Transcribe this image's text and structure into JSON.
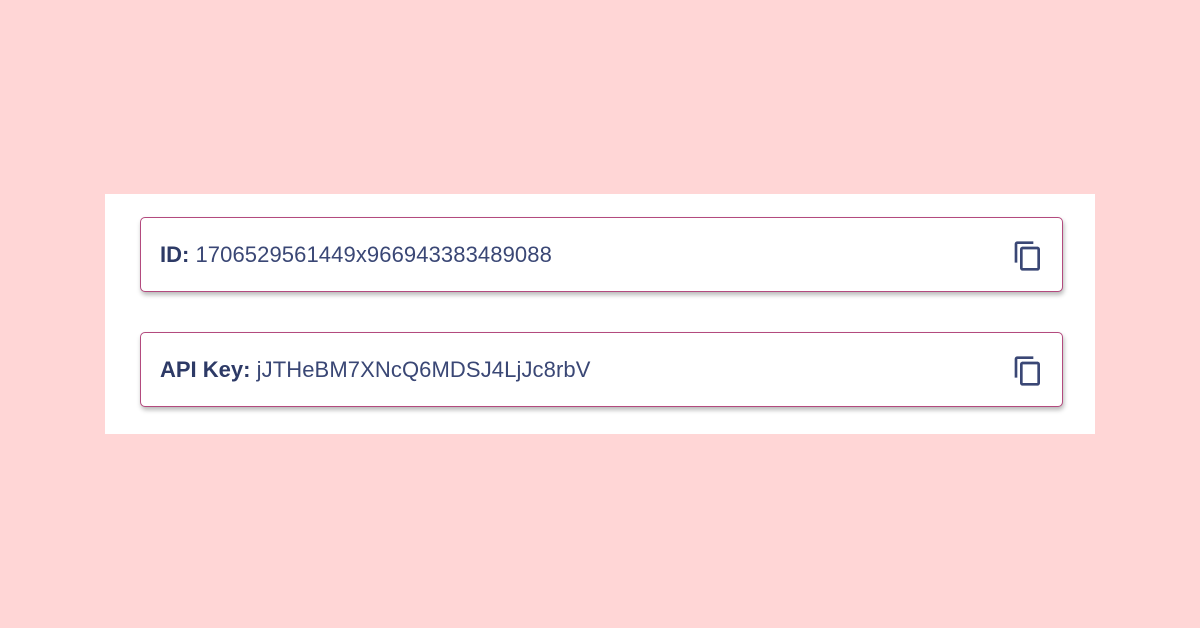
{
  "credentials": {
    "id": {
      "label": "ID:",
      "value": "1706529561449x966943383489088"
    },
    "api_key": {
      "label": "API Key:",
      "value": "jJTHeBM7XNcQ6MDSJ4LjJc8rbV"
    }
  },
  "icons": {
    "copy": "copy-icon"
  },
  "colors": {
    "background": "#ffd6d6",
    "panel": "#ffffff",
    "field_border": "#b34a7e",
    "text": "#34416e"
  }
}
